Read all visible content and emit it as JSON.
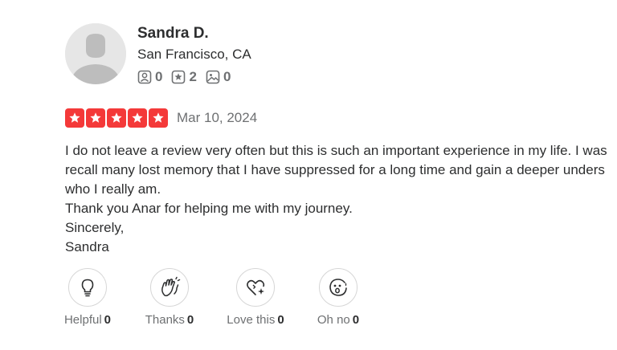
{
  "user": {
    "name": "Sandra D.",
    "location": "San Francisco, CA",
    "stats": {
      "friends": "0",
      "reviews": "2",
      "photos": "0"
    }
  },
  "review": {
    "rating": 5,
    "date": "Mar 10, 2024",
    "body_lines": [
      "I do not leave a review very often but this is such an important experience in my life. I was",
      "recall many lost memory that I have suppressed for a long time and gain a deeper unders",
      "who I really am.",
      "Thank you Anar for helping me with my journey.",
      "Sincerely,",
      "Sandra"
    ]
  },
  "reactions": [
    {
      "label": "Helpful",
      "count": "0",
      "icon": "lightbulb-icon"
    },
    {
      "label": "Thanks",
      "count": "0",
      "icon": "clapping-hands-icon"
    },
    {
      "label": "Love this",
      "count": "0",
      "icon": "heart-sparkle-icon"
    },
    {
      "label": "Oh no",
      "count": "0",
      "icon": "surprised-face-icon"
    }
  ],
  "colors": {
    "star_red": "#f43939",
    "text_dark": "#2d2e2f",
    "text_gray": "#6e7072"
  }
}
